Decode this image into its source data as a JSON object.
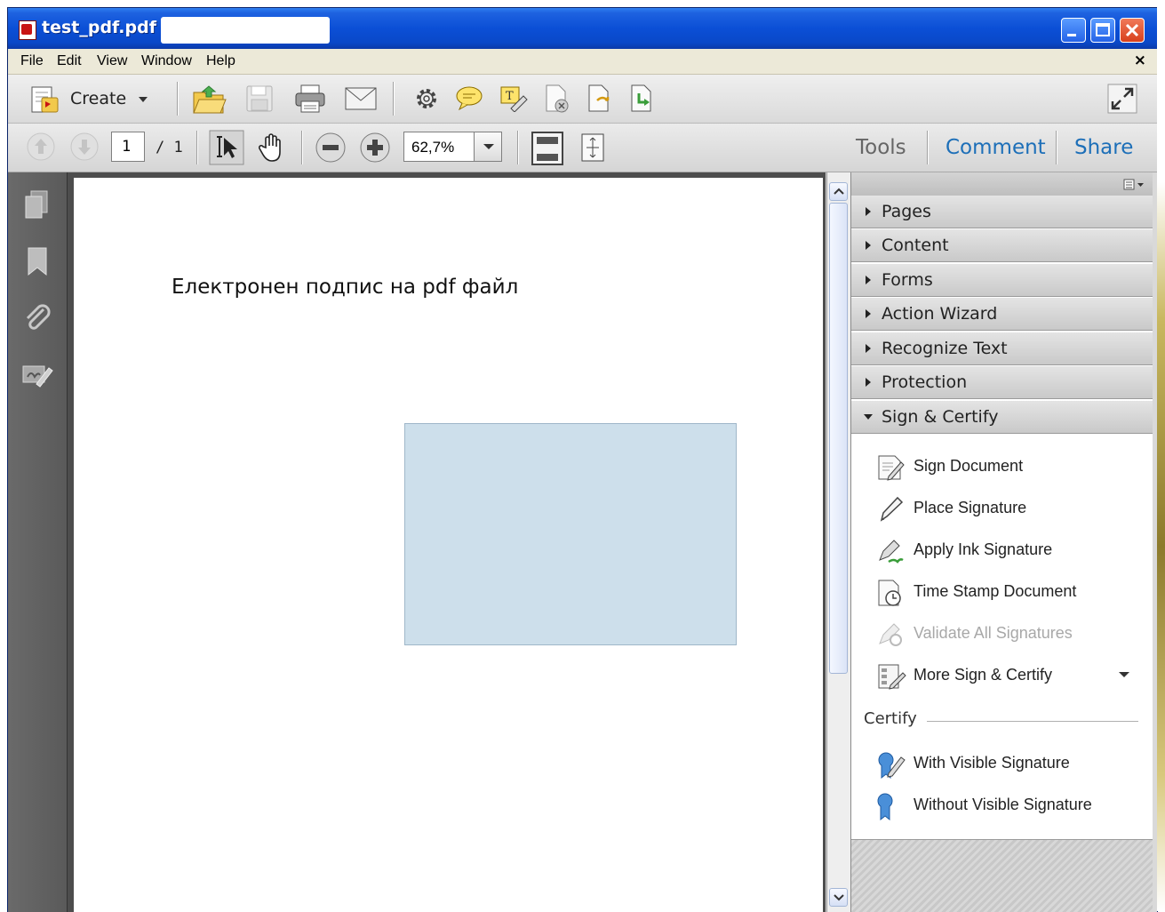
{
  "titlebar": {
    "title": "test_pdf.pdf -"
  },
  "menubar": {
    "items": [
      "File",
      "Edit",
      "View",
      "Window",
      "Help"
    ],
    "close": "×"
  },
  "toolbar1": {
    "create_label": "Create"
  },
  "toolbar2": {
    "page_current": "1",
    "page_total": "/ 1",
    "zoom": "62,7%",
    "tabs": [
      "Tools",
      "Comment",
      "Share"
    ]
  },
  "document": {
    "heading": "Електронен подпис на pdf файл"
  },
  "tools_pane": {
    "panels": [
      "Pages",
      "Content",
      "Forms",
      "Action Wizard",
      "Recognize Text",
      "Protection",
      "Sign & Certify"
    ],
    "sign_tools": [
      {
        "label": "Sign Document",
        "icon": "sign-document-icon"
      },
      {
        "label": "Place Signature",
        "icon": "pen-icon"
      },
      {
        "label": "Apply Ink Signature",
        "icon": "ink-pen-icon"
      },
      {
        "label": "Time Stamp Document",
        "icon": "clock-document-icon"
      },
      {
        "label": "Validate All Signatures",
        "icon": "validate-pen-icon"
      },
      {
        "label": "More Sign & Certify",
        "icon": "more-sign-icon"
      }
    ],
    "certify_label": "Certify",
    "certify_tools": [
      {
        "label": "With Visible Signature",
        "icon": "ribbon-pen-icon"
      },
      {
        "label": "Without Visible Signature",
        "icon": "ribbon-icon"
      }
    ]
  },
  "colors": {
    "titlebar": "#0b4fd6",
    "tab_active": "#1d6fb8",
    "signature_field": "#cddfeb"
  }
}
